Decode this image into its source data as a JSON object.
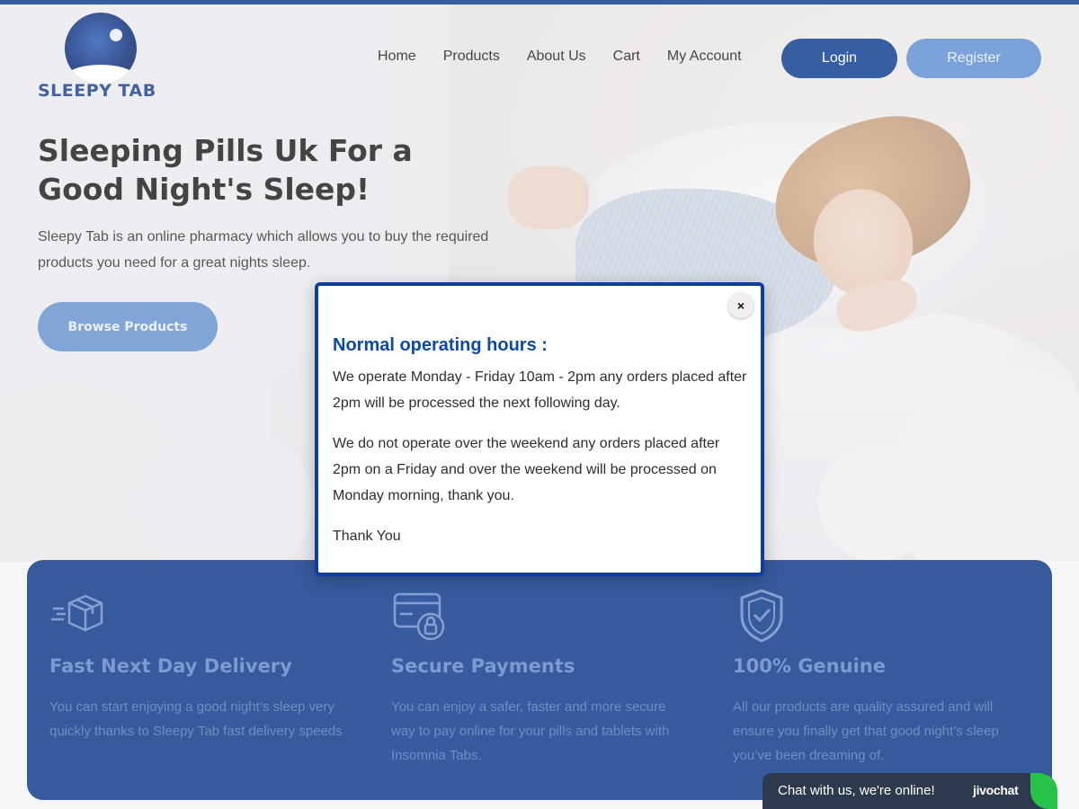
{
  "header": {
    "logo_text": "SLEEPY TAB",
    "nav": [
      "Home",
      "Products",
      "About Us",
      "Cart",
      "My Account"
    ],
    "login_label": "Login",
    "register_label": "Register"
  },
  "hero": {
    "title": "Sleeping Pills Uk For a Good Night's Sleep!",
    "text": "Sleepy Tab is an online pharmacy which allows you to buy the required products you need for a great nights sleep.",
    "button_label": "Browse Products"
  },
  "features": [
    {
      "icon": "delivery-box-icon",
      "title": "Fast Next Day Delivery",
      "text": "You can start enjoying a good night’s sleep very quickly thanks to Sleepy Tab fast delivery speeds"
    },
    {
      "icon": "secure-card-icon",
      "title": "Secure Payments",
      "text": "You can enjoy a safer, faster and more secure way to pay online for your pills and tablets with Insomnia Tabs."
    },
    {
      "icon": "shield-check-icon",
      "title": "100% Genuine",
      "text": "All our products are quality assured and will ensure you finally get that good night’s sleep you’ve been dreaming of."
    }
  ],
  "modal": {
    "close_label": "×",
    "title": "Normal operating hours :",
    "paragraphs": [
      "We operate Monday - Friday 10am - 2pm any orders placed after 2pm will be processed the next following day.",
      "We do not operate over the weekend any orders placed after 2pm on a Friday and over the weekend will be processed on Monday morning, thank you.",
      "Thank You"
    ]
  },
  "chat": {
    "text": "Chat with us, we're online!",
    "brand": "jivochat"
  },
  "colors": {
    "brand_blue": "#0a3687",
    "accent_light_blue": "#6792cf",
    "modal_title": "#0c4aa6",
    "chat_green": "#27c24a"
  }
}
